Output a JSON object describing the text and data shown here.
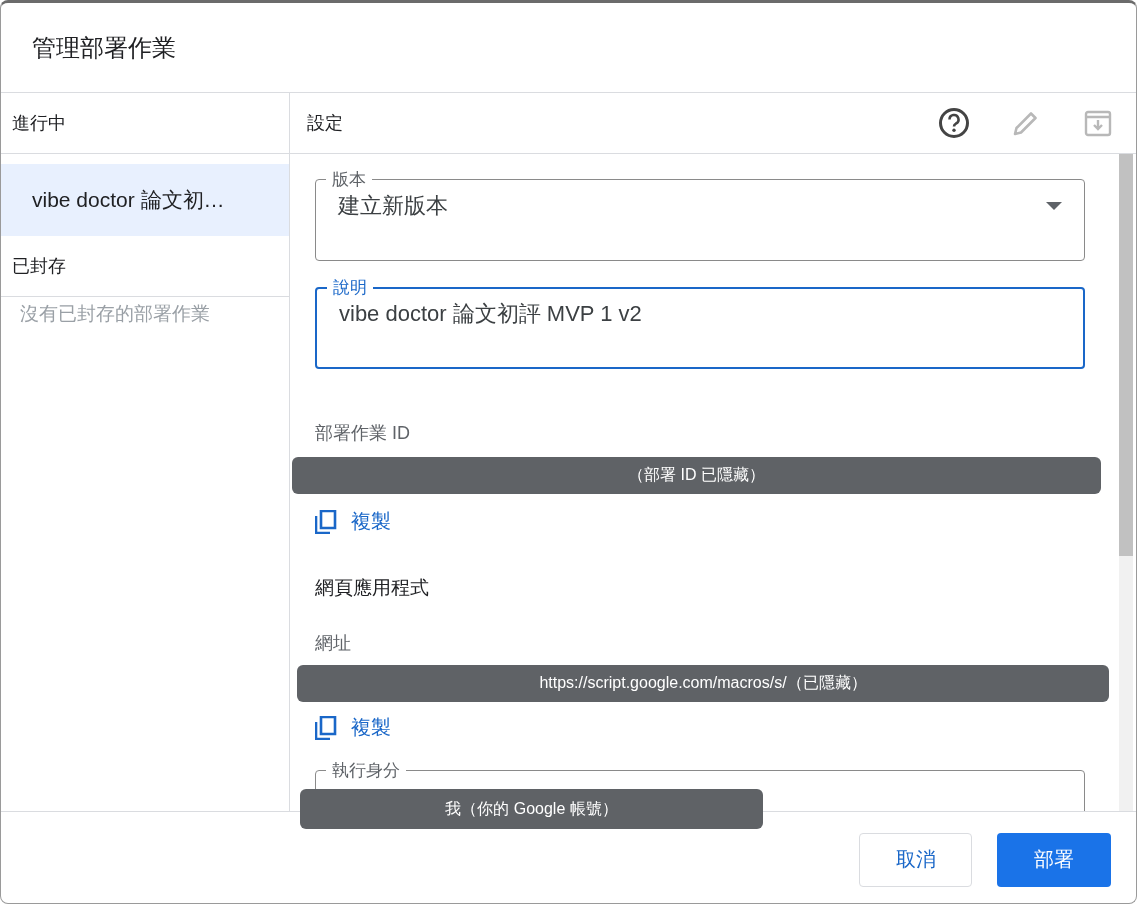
{
  "dialog": {
    "title": "管理部署作業"
  },
  "sidebar": {
    "sections": [
      {
        "heading": "進行中",
        "items": [
          {
            "label": "vibe doctor 論文初…",
            "selected": true
          }
        ]
      },
      {
        "heading": "已封存",
        "empty_text": "沒有已封存的部署作業"
      }
    ]
  },
  "settings": {
    "heading": "設定",
    "toolbar": [
      {
        "kind": "help",
        "disabled": false
      },
      {
        "kind": "edit",
        "disabled": true
      },
      {
        "kind": "archive",
        "disabled": true
      }
    ],
    "version_field": {
      "label": "版本",
      "value": "建立新版本"
    },
    "description_field": {
      "label": "說明",
      "value": "vibe doctor 論文初評 MVP 1 v2",
      "focused": true
    },
    "deployment_id": {
      "label": "部署作業 ID",
      "value": "（部署 ID 已隱藏）",
      "copy_label": "複製"
    },
    "web_app": {
      "heading": "網頁應用程式",
      "url_label": "網址",
      "url": "https://script.google.com/macros/s/（已隱藏）",
      "copy_label": "複製",
      "run_as": {
        "label": "執行身分",
        "value": "我（你的 Google 帳號）"
      }
    }
  },
  "buttons": [
    {
      "label": "取消",
      "kind": "secondary"
    },
    {
      "label": "部署",
      "kind": "primary"
    }
  ]
}
